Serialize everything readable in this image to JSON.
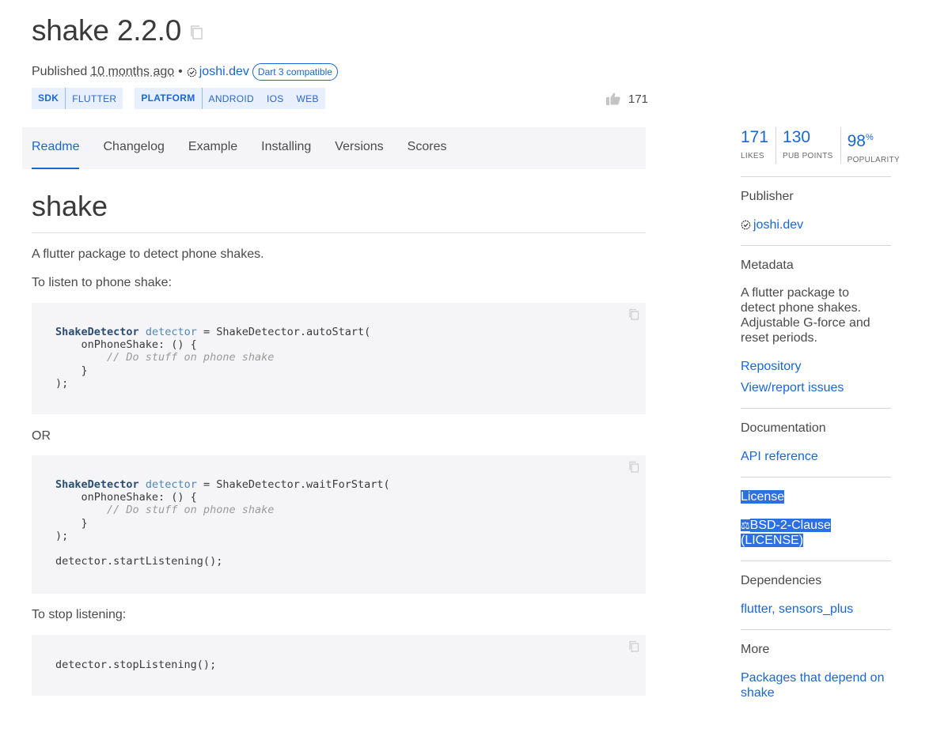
{
  "header": {
    "title": "shake 2.2.0",
    "published_prefix": "Published",
    "published_ago": "10 months ago",
    "separator": "•",
    "publisher": "joshi.dev",
    "dart_badge": "Dart 3 compatible",
    "likes": "171"
  },
  "tags": {
    "sdk_label": "SDK",
    "sdk_items": [
      "FLUTTER"
    ],
    "platform_label": "PLATFORM",
    "platform_items": [
      "ANDROID",
      "IOS",
      "WEB"
    ]
  },
  "tabs": [
    {
      "label": "Readme",
      "active": true
    },
    {
      "label": "Changelog",
      "active": false
    },
    {
      "label": "Example",
      "active": false
    },
    {
      "label": "Installing",
      "active": false
    },
    {
      "label": "Versions",
      "active": false
    },
    {
      "label": "Scores",
      "active": false
    }
  ],
  "readme": {
    "heading": "shake",
    "intro": "A flutter package to detect phone shakes.",
    "listen_label": "To listen to phone shake:",
    "or_label": "OR",
    "stop_label": "To stop listening:",
    "code1": {
      "type": "ShakeDetector",
      "var": "detector",
      "assign": " = ShakeDetector.autoStart(",
      "line2": "    onPhoneShake: () {",
      "comment": "        // Do stuff on phone shake",
      "line4": "    }",
      "line5": ");"
    },
    "code2": {
      "type": "ShakeDetector",
      "var": "detector",
      "assign": " = ShakeDetector.waitForStart(",
      "line2": "    onPhoneShake: () {",
      "comment": "        // Do stuff on phone shake",
      "line4": "    }",
      "line5": ");",
      "line7": "detector.startListening();"
    },
    "code3": {
      "line1": "detector.stopListening();"
    }
  },
  "sidebar": {
    "stats": [
      {
        "value": "171",
        "suffix": "",
        "label": "LIKES"
      },
      {
        "value": "130",
        "suffix": "",
        "label": "PUB POINTS"
      },
      {
        "value": "98",
        "suffix": "%",
        "label": "POPULARITY"
      }
    ],
    "publisher_heading": "Publisher",
    "publisher": "joshi.dev",
    "metadata_heading": "Metadata",
    "description": "A flutter package to detect phone shakes. Adjustable G-force and reset periods.",
    "repository": "Repository",
    "issues": "View/report issues",
    "documentation_heading": "Documentation",
    "api_reference": "API reference",
    "license_heading": "License",
    "license_line1": "BSD-2-Clause",
    "license_line2": "(LICENSE)",
    "dependencies_heading": "Dependencies",
    "dependencies": "flutter, sensors_plus",
    "more_heading": "More",
    "more_link": "Packages that depend on shake"
  },
  "colors": {
    "accent": "#1967d2",
    "tab_bar": "#f5f5f7",
    "tag_bg": "#e8f0fe",
    "selection": "#2c6fe0"
  }
}
